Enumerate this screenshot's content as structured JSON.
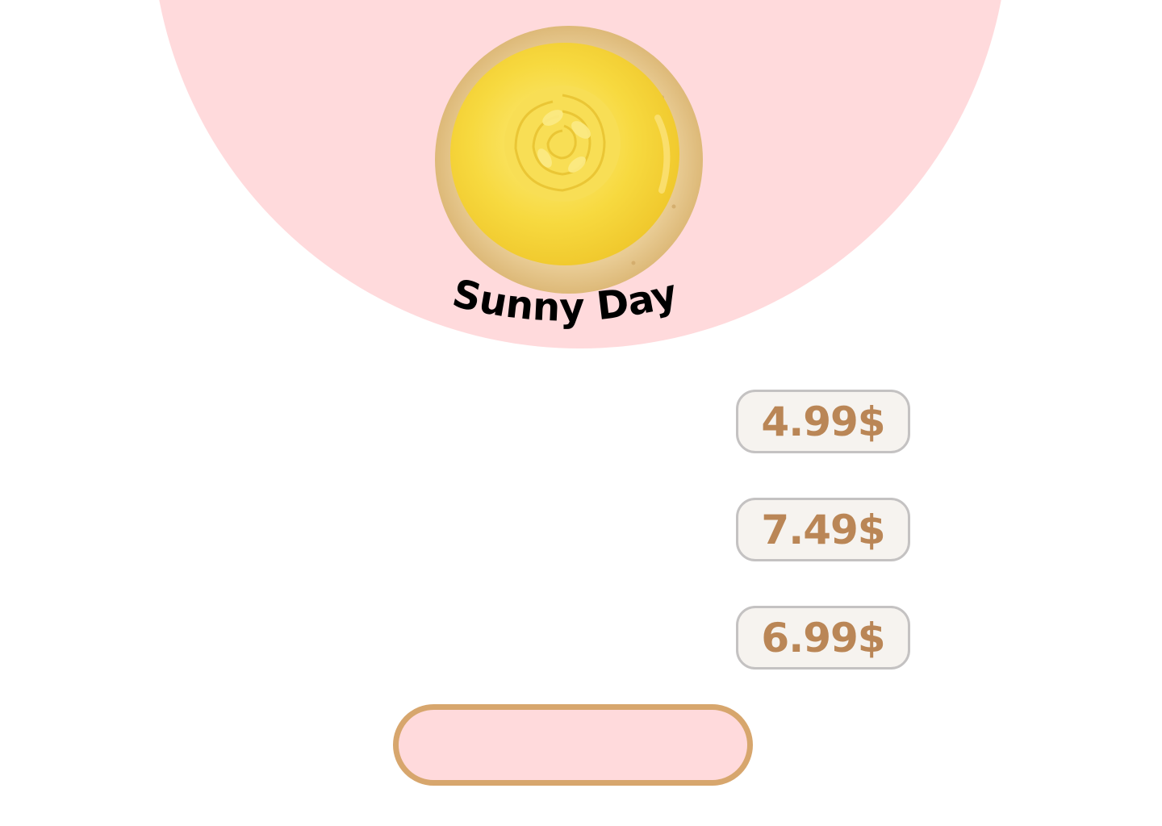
{
  "colors": {
    "hero_background": "#FFDADC",
    "price_text": "#BA8656",
    "price_border": "#C4C2C2",
    "price_fill": "#F6F3EF",
    "button_border": "#D7A66D",
    "button_fill": "#FFDADC",
    "frosting": "#F6D63B"
  },
  "product": {
    "name": "Sunny Day",
    "image_icon": "yellow-frosted-cookie"
  },
  "prices": [
    {
      "label": "4.99$"
    },
    {
      "label": "7.49$"
    },
    {
      "label": "6.99$"
    }
  ],
  "add_button": {
    "label": ""
  }
}
